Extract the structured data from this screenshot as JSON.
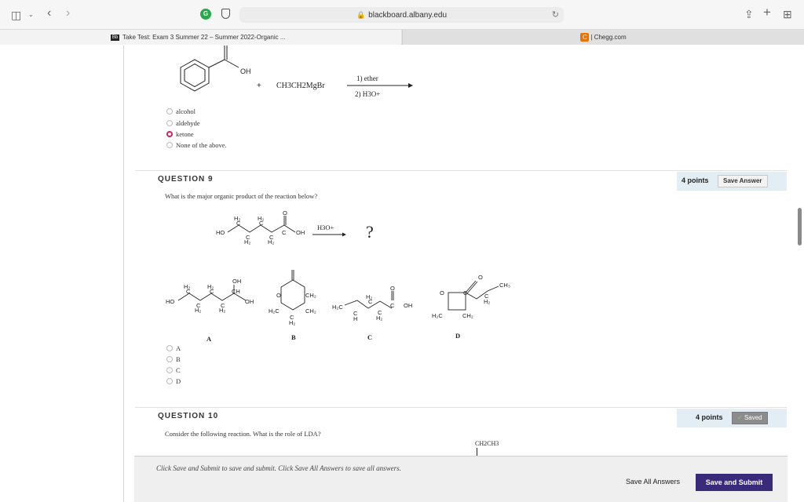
{
  "browser": {
    "url": "blackboard.albany.edu",
    "tabs": [
      {
        "title": "Take Test: Exam 3 Summer 22 – Summer 2022-Organic ...",
        "favicon": "Bb"
      },
      {
        "title": "| Chegg.com",
        "favicon": "C"
      }
    ]
  },
  "q8": {
    "structure_labels": {
      "oh": "OH",
      "plus": "+",
      "reagent": "CH3CH2MgBr",
      "step1": "1) ether",
      "step2": "2) H3O+"
    },
    "options": [
      {
        "label": "alcohol",
        "selected": false
      },
      {
        "label": "aldehyde",
        "selected": false
      },
      {
        "label": "ketone",
        "selected": true
      },
      {
        "label": "None of the above.",
        "selected": false
      }
    ]
  },
  "q9": {
    "title": "QUESTION 9",
    "text": "What is the major organic product of the reaction below?",
    "points": "4 points",
    "save_label": "Save Answer",
    "reagent": "H3O+",
    "question_mark": "?",
    "structure_labels": [
      "A",
      "B",
      "C",
      "D"
    ],
    "options": [
      {
        "label": "A",
        "selected": false
      },
      {
        "label": "B",
        "selected": false
      },
      {
        "label": "C",
        "selected": false
      },
      {
        "label": "D",
        "selected": false
      }
    ]
  },
  "q10": {
    "title": "QUESTION 10",
    "text": "Consider the following reaction. What is the role of LDA?",
    "points": "4 points",
    "saved_label": "Saved",
    "fragment": "CH2CH3"
  },
  "footer": {
    "instruction": "Click Save and Submit to save and submit. Click Save All Answers to save all answers.",
    "save_all": "Save All Answers",
    "submit": "Save and Submit"
  }
}
